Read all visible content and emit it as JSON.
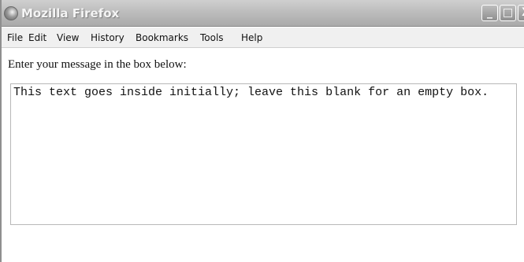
{
  "window": {
    "title": "Mozilla Firefox",
    "controls": {
      "minimize": "_",
      "maximize": "□",
      "close": "X"
    }
  },
  "menubar": {
    "items": [
      {
        "label": "File"
      },
      {
        "label": "Edit"
      },
      {
        "label": "View"
      },
      {
        "label": "History"
      },
      {
        "label": "Bookmarks"
      },
      {
        "label": "Tools"
      },
      {
        "label": "Help"
      }
    ]
  },
  "main": {
    "prompt": "Enter your message in the box below:",
    "textarea_value": "This text goes inside initially; leave this blank for an empty box."
  }
}
